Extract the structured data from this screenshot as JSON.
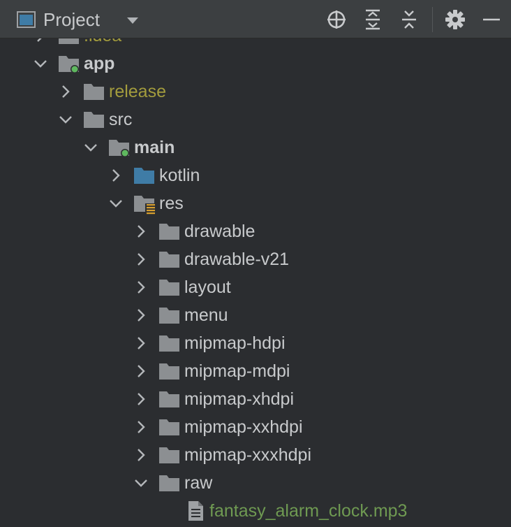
{
  "toolbar": {
    "title": "Project",
    "icons": {
      "view": "project-view-icon",
      "dropdown": "chevron-down-icon",
      "locate": "crosshair-icon",
      "expand": "expand-all-icon",
      "collapse": "collapse-all-icon",
      "settings": "gear-icon",
      "hide": "minimize-icon"
    }
  },
  "tree": {
    "items": [
      {
        "label": ".idea",
        "icon": "folder-icon",
        "expanded": false
      },
      {
        "label": "app",
        "icon": "module-folder-icon",
        "expanded": true
      },
      {
        "label": "release",
        "icon": "folder-icon",
        "expanded": false
      },
      {
        "label": "src",
        "icon": "folder-icon",
        "expanded": true
      },
      {
        "label": "main",
        "icon": "module-folder-icon",
        "expanded": true
      },
      {
        "label": "kotlin",
        "icon": "source-folder-icon",
        "expanded": false
      },
      {
        "label": "res",
        "icon": "resource-folder-icon",
        "expanded": true
      },
      {
        "label": "drawable",
        "icon": "folder-icon",
        "expanded": false
      },
      {
        "label": "drawable-v21",
        "icon": "folder-icon",
        "expanded": false
      },
      {
        "label": "layout",
        "icon": "folder-icon",
        "expanded": false
      },
      {
        "label": "menu",
        "icon": "folder-icon",
        "expanded": false
      },
      {
        "label": "mipmap-hdpi",
        "icon": "folder-icon",
        "expanded": false
      },
      {
        "label": "mipmap-mdpi",
        "icon": "folder-icon",
        "expanded": false
      },
      {
        "label": "mipmap-xhdpi",
        "icon": "folder-icon",
        "expanded": false
      },
      {
        "label": "mipmap-xxhdpi",
        "icon": "folder-icon",
        "expanded": false
      },
      {
        "label": "mipmap-xxxhdpi",
        "icon": "folder-icon",
        "expanded": false
      },
      {
        "label": "raw",
        "icon": "folder-icon",
        "expanded": true
      },
      {
        "label": "fantasy_alarm_clock.mp3",
        "icon": "text-file-icon"
      }
    ]
  },
  "colors": {
    "background": "#2b2d30",
    "toolbar": "#3c3f41",
    "text": "#c8cacc",
    "excluded": "#a39c3d",
    "audio_file": "#6f9a52",
    "folder": "#8c8f92",
    "source_folder": "#3f7ca6",
    "module_dot": "#5fb85f",
    "resource_badge": "#d69e2e"
  }
}
